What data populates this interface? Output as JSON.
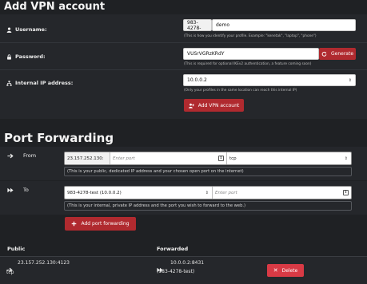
{
  "vpn": {
    "title": "Add VPN account",
    "username": {
      "label": "Username:",
      "prefix": "983-4278-",
      "value": "demo",
      "help": "(This is how you identify your profile. Example: \"kenetak\", \"laptop\", \"phone\")"
    },
    "password": {
      "label": "Password:",
      "value": "VUSrVGRzKRdY",
      "generate_label": "Generate",
      "help": "(This is required for optional IKEv2 authentication, a feature coming soon)"
    },
    "ip": {
      "label": "Internal IP address:",
      "value": "10.0.0.2",
      "help": "(Only your profiles in the same location can reach this internal IP)"
    },
    "add_label": "Add VPN account"
  },
  "pf": {
    "title": "Port Forwarding",
    "from": {
      "label": "From",
      "ip": "23.157.252.130:",
      "port_placeholder": "Enter port",
      "protocol": "tcp",
      "help": "(This is your public, dedicated IP address and your chosen open port on the internet)"
    },
    "to": {
      "label": "To",
      "target": "983-4278-test (10.0.0.2)",
      "port_placeholder": "Enter port",
      "help": "(This is your internal, private IP address and the port you wish to forward to the web.)"
    },
    "add_label": "Add port forwarding"
  },
  "table": {
    "col_public": "Public",
    "col_forwarded": "Forwarded",
    "rows": [
      {
        "public": "23.157.252.130:4123",
        "protocol": "tcp",
        "forwarded": "10.0.0.2:8431",
        "forwarded_name": "(983-4278-test)",
        "delete_label": "Delete"
      }
    ]
  },
  "colors": {
    "background": "#1f2124",
    "panel": "#25272b",
    "accent_red": "#b02a2f",
    "delete_red": "#d83a45"
  },
  "icons": [
    "user-icon",
    "key-icon",
    "network-icon",
    "refresh-icon",
    "user-plus-icon",
    "arrow-right-icon",
    "fast-forward-icon",
    "plus-icon",
    "close-icon"
  ]
}
